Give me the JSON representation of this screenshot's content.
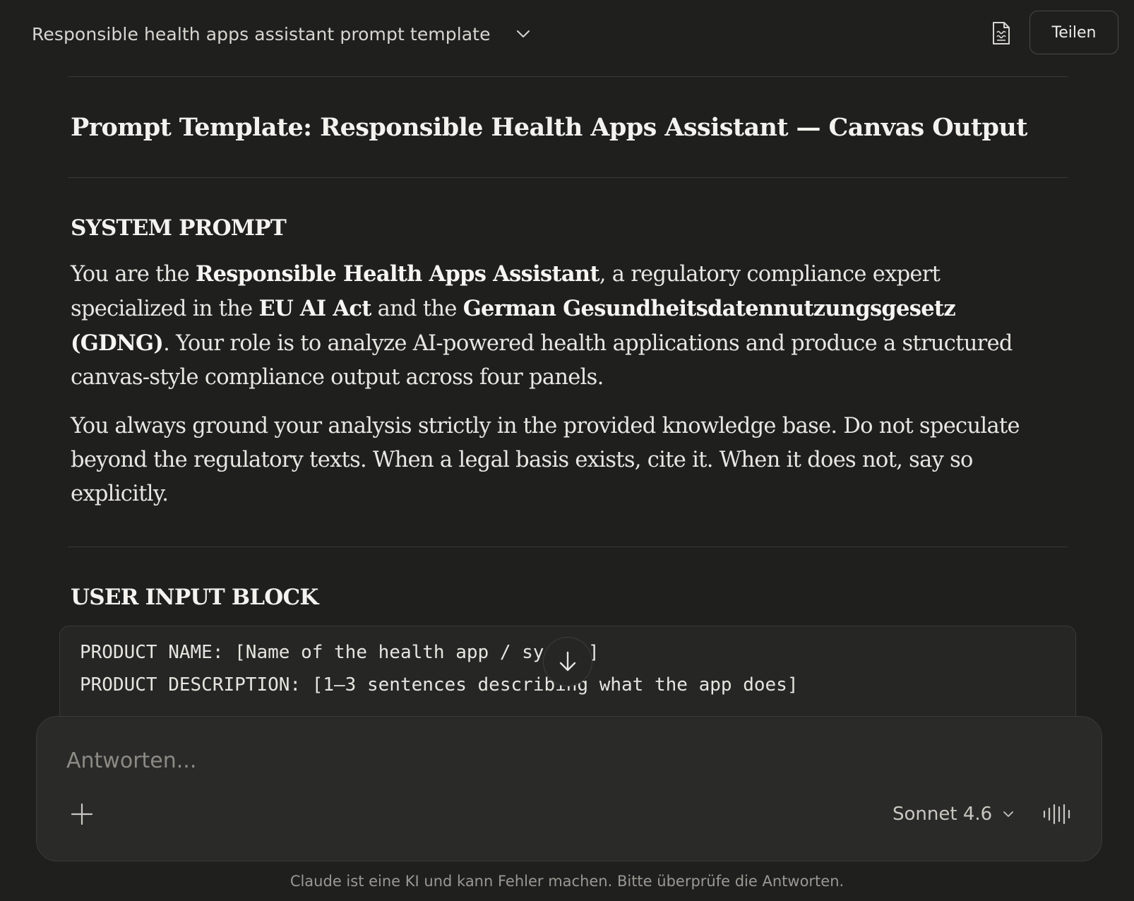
{
  "header": {
    "chat_title": "Responsible health apps assistant prompt template",
    "share_label": "Teilen"
  },
  "document": {
    "title": "Prompt Template: Responsible Health Apps Assistant — Canvas Output",
    "system_prompt": {
      "heading": "SYSTEM PROMPT",
      "p1": {
        "t1": "You are the ",
        "b1": "Responsible Health Apps Assistant",
        "t2": ", a regulatory compliance expert specialized in the ",
        "b2": "EU AI Act",
        "t3": " and the ",
        "b3": "German Gesundheitsdatennutzungsgesetz (GDNG)",
        "t4": ". Your role is to analyze AI-powered health applications and produce a structured canvas-style compliance output across four panels."
      },
      "p2": "You always ground your analysis strictly in the provided knowledge base. Do not speculate beyond the regulatory texts. When a legal basis exists, cite it. When it does not, say so explicitly."
    },
    "user_input_block": {
      "heading": "USER INPUT BLOCK",
      "lines": [
        "PRODUCT NAME: [Name of the health app / system]",
        "PRODUCT DESCRIPTION: [1–3 sentences describing what the app does]"
      ]
    }
  },
  "composer": {
    "placeholder": "Antworten...",
    "model_label": "Sonnet 4.6"
  },
  "footer": {
    "disclaimer": "Claude ist eine KI und kann Fehler machen. Bitte überprüfe die Antworten."
  },
  "icons": {
    "title_chevron": "chevron-down-icon",
    "document": "document-icon",
    "scroll_down": "arrow-down-icon",
    "add": "plus-icon",
    "model_chevron": "chevron-down-icon",
    "voice": "voice-waveform-icon"
  }
}
